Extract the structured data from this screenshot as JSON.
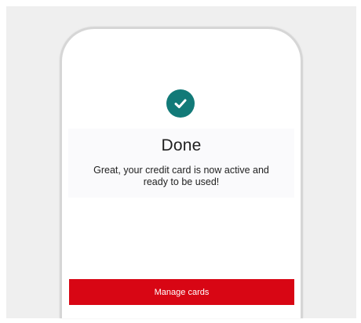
{
  "status": {
    "icon": "checkmark-icon",
    "color": "#127a78"
  },
  "confirmation": {
    "title": "Done",
    "message": "Great, your credit card is now active and ready to be used!"
  },
  "actions": {
    "manage_cards_label": "Manage cards",
    "primary_color": "#d80614"
  }
}
